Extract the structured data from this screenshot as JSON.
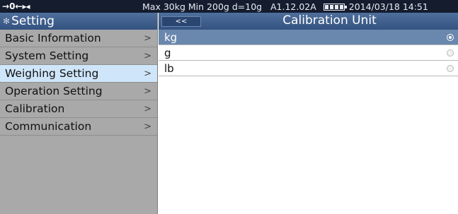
{
  "status_bar": {
    "zero_indicator": "0",
    "max": "Max 30kg",
    "min": "Min 200g",
    "division": "d=10g",
    "version": "A1.12.02A",
    "datetime": "2014/03/18  14:51"
  },
  "sidebar": {
    "title": "Setting",
    "items": [
      {
        "label": "Basic Information",
        "chevron": ">"
      },
      {
        "label": "System Setting",
        "chevron": ">"
      },
      {
        "label": "Weighing Setting",
        "chevron": ">"
      },
      {
        "label": "Operation Setting",
        "chevron": ">"
      },
      {
        "label": "Calibration",
        "chevron": ">"
      },
      {
        "label": "Communication",
        "chevron": ">"
      }
    ],
    "active_index": 2
  },
  "panel": {
    "back_label": "<<",
    "title": "Calibration Unit",
    "options": [
      {
        "label": "kg",
        "selected": true
      },
      {
        "label": "g",
        "selected": false
      },
      {
        "label": "lb",
        "selected": false
      }
    ]
  },
  "colors": {
    "status_bar_bg": "#141c2e",
    "header_bg": "#3f5f8c",
    "selected_row": "#6a88ae",
    "active_menu": "#cfe6fa",
    "sidebar_bg": "#a9a9a9"
  }
}
